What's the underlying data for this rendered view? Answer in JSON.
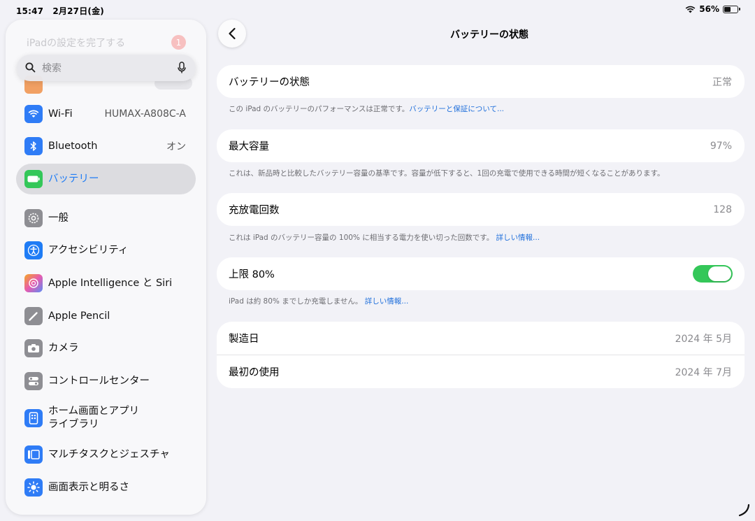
{
  "status_bar": {
    "time": "15:47",
    "date": "2月27日(金)",
    "battery_percent": "56%",
    "battery_level": 0.56
  },
  "sidebar": {
    "setup_text": "iPadの設定を完了する",
    "setup_badge": "1",
    "search": {
      "placeholder": "検索",
      "value": ""
    },
    "items": [
      {
        "label": "Wi-Fi",
        "value": "HUMAX-A808C-A",
        "icon": "wifi-icon",
        "color": "#2f7cf6"
      },
      {
        "label": "Bluetooth",
        "value": "オン",
        "icon": "bluetooth-icon",
        "color": "#2f7cf6"
      },
      {
        "label": "バッテリー",
        "value": "",
        "icon": "battery-icon",
        "color": "#34c759",
        "selected": true
      },
      {
        "label": "一般",
        "value": "",
        "icon": "gear-icon",
        "color": "#8e8e93"
      },
      {
        "label": "アクセシビリティ",
        "value": "",
        "icon": "accessibility-icon",
        "color": "#1f7cf5"
      },
      {
        "label": "Apple Intelligence と Siri",
        "value": "",
        "icon": "apple-intelligence-icon",
        "color": "#e65bb0"
      },
      {
        "label": "Apple Pencil",
        "value": "",
        "icon": "pencil-icon",
        "color": "#8e8e93"
      },
      {
        "label": "カメラ",
        "value": "",
        "icon": "camera-icon",
        "color": "#8e8e93"
      },
      {
        "label": "コントロールセンター",
        "value": "",
        "icon": "control-center-icon",
        "color": "#8e8e93"
      },
      {
        "label": "ホーム画面とアプリ",
        "label2": "ライブラリ",
        "value": "",
        "icon": "home-screen-icon",
        "color": "#2f7cf6"
      },
      {
        "label": "マルチタスクとジェスチャ",
        "value": "",
        "icon": "multitasking-icon",
        "color": "#2f7cf6"
      },
      {
        "label": "画面表示と明るさ",
        "value": "",
        "icon": "brightness-icon",
        "color": "#2f7cf6"
      }
    ]
  },
  "main": {
    "title": "バッテリーの状態",
    "health": {
      "label": "バッテリーの状態",
      "value": "正常",
      "note": "この iPad のバッテリーのパフォーマンスは正常です。",
      "link": "バッテリーと保証について..."
    },
    "capacity": {
      "label": "最大容量",
      "value": "97%",
      "note": "これは、新品時と比較したバッテリー容量の基準です。容量が低下すると、1回の充電で使用できる時間が短くなることがあります。"
    },
    "cycles": {
      "label": "充放電回数",
      "value": "128",
      "note": "これは iPad のバッテリー容量の 100% に相当する電力を使い切った回数です。",
      "link": "詳しい情報..."
    },
    "limit": {
      "label": "上限 80%",
      "enabled": true,
      "note": "iPad は約 80% までしか充電しません。",
      "link": "詳しい情報..."
    },
    "manufacture": {
      "label": "製造日",
      "value": "2024 年 5月"
    },
    "first_use": {
      "label": "最初の使用",
      "value": "2024 年 7月"
    }
  }
}
